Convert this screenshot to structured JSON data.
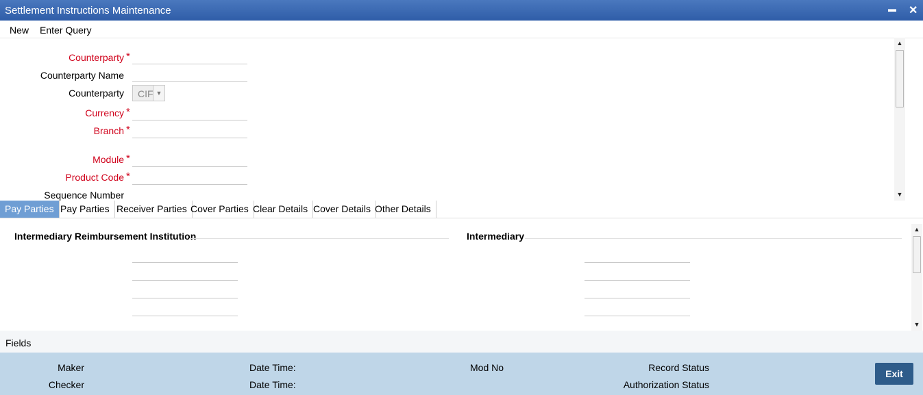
{
  "window": {
    "title": "Settlement Instructions Maintenance",
    "minimize_glyph": "▬",
    "close_glyph": "✕"
  },
  "menu": {
    "new_label": "New",
    "enter_query_label": "Enter Query"
  },
  "form": {
    "counterparty_label": "Counterparty",
    "counterparty_name_label": "Counterparty Name",
    "counterparty_type_label": "Counterparty",
    "counterparty_type_value": "CIF",
    "currency_label": "Currency",
    "branch_label": "Branch",
    "module_label": "Module",
    "product_code_label": "Product Code",
    "sequence_number_label": "Sequence Number",
    "required_marker": "*"
  },
  "tabs": [
    {
      "label": "Pay Parties",
      "active": true
    },
    {
      "label": "Pay Parties",
      "active": false
    },
    {
      "label": "Receiver Parties",
      "active": false
    },
    {
      "label": "Cover Parties",
      "active": false
    },
    {
      "label": "Clear Details",
      "active": false
    },
    {
      "label": "Cover Details",
      "active": false
    },
    {
      "label": "Other Details",
      "active": false
    }
  ],
  "panel": {
    "left_heading": "Intermediary Reimbursement Institution",
    "right_heading": "Intermediary"
  },
  "footer": {
    "fields_label": "Fields",
    "maker_label": "Maker",
    "checker_label": "Checker",
    "date_time_label_1": "Date Time:",
    "date_time_label_2": "Date Time:",
    "mod_no_label": "Mod No",
    "record_status_label": "Record Status",
    "authorization_status_label": "Authorization Status",
    "exit_label": "Exit"
  },
  "colors": {
    "title_bar": "#2f5da8",
    "active_tab": "#6f9ed4",
    "required": "#d0021b",
    "audit_bar": "#bfd6e8",
    "exit_button": "#2e5c8a"
  },
  "icons": {
    "scroll_up": "scroll-up-arrow-icon",
    "scroll_down": "scroll-down-arrow-icon",
    "dropdown": "chevron-down-icon"
  }
}
